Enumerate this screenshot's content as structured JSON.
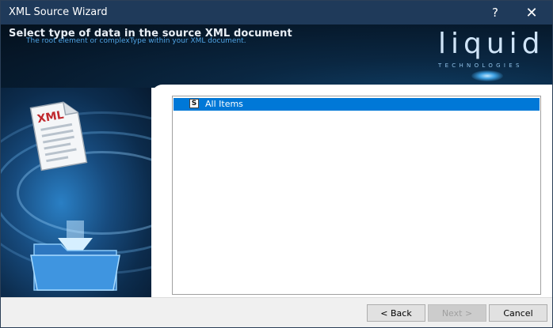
{
  "window": {
    "title": "XML Source Wizard",
    "help_label": "?",
    "close_label": "✕"
  },
  "header": {
    "title": "Select type of data in the source XML document",
    "subtitle": "The root element or complexType within your XML document."
  },
  "logo": {
    "word": "liquid",
    "tagline": "TECHNOLOGIES"
  },
  "illustration": {
    "doc_label": "XML"
  },
  "list": {
    "items": [
      {
        "icon_label": "S",
        "label": "All Items",
        "selected": true
      }
    ]
  },
  "footer": {
    "back_label": "< Back",
    "next_label": "Next >",
    "cancel_label": "Cancel"
  },
  "colors": {
    "title_bar": "#1f3a5a",
    "selection": "#0078d7",
    "subtitle": "#4fa2e2"
  }
}
